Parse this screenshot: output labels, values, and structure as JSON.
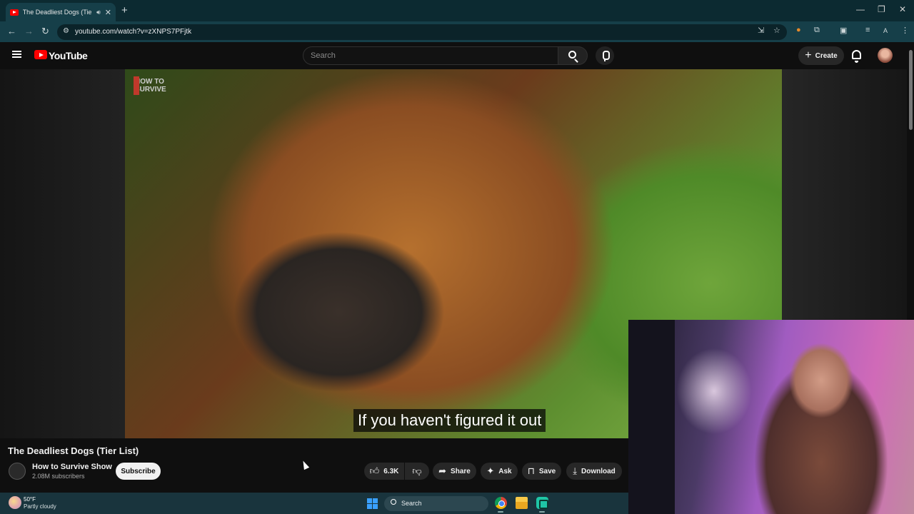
{
  "browser": {
    "tab_title": "The Deadliest Dogs (Tier List)",
    "tab_title_visible": "The Deadliest Dogs (Tier Li",
    "url": "youtube.com/watch?v=zXNPS7PFjtk",
    "profile_initial": "A"
  },
  "youtube": {
    "logo_text": "YouTube",
    "search_placeholder": "Search",
    "create_label": "Create"
  },
  "video": {
    "watermark_line1": "HOW TO",
    "watermark_line2": "SURVIVE",
    "caption": "If you haven't figured it out",
    "title": "The Deadliest Dogs (Tier List)"
  },
  "channel": {
    "name": "How to Survive Show",
    "subscribers": "2.08M subscribers",
    "subscribe_label": "Subscribe"
  },
  "actions": {
    "likes": "6.3K",
    "share": "Share",
    "ask": "Ask",
    "save": "Save",
    "download": "Download"
  },
  "taskbar": {
    "temperature": "50°F",
    "weather": "Partly cloudy",
    "search_placeholder": "Search"
  },
  "colors": {
    "youtube_red": "#ff0000",
    "browser_frame": "#163f49",
    "taskbar": "#19343d"
  }
}
